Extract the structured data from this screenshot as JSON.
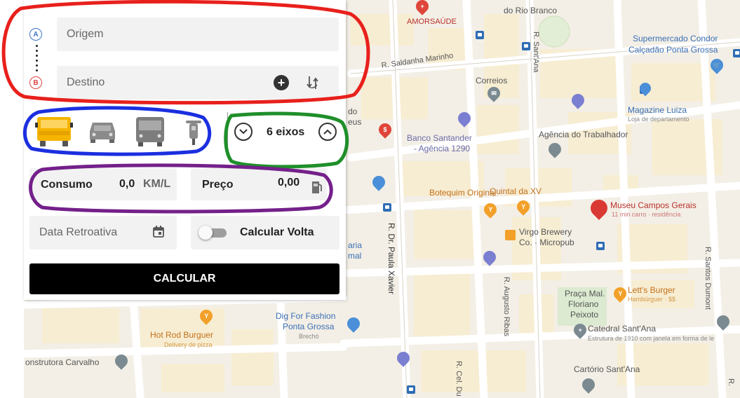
{
  "panel": {
    "origin_placeholder": "Origem",
    "destination_placeholder": "Destino",
    "origin_marker": "A",
    "destination_marker": "B",
    "vehicles": [
      {
        "name": "truck",
        "selected": true
      },
      {
        "name": "car",
        "selected": false
      },
      {
        "name": "bus",
        "selected": false
      },
      {
        "name": "motorcycle",
        "selected": false
      }
    ],
    "axles_label": "6 eixos",
    "consumption": {
      "label": "Consumo",
      "value": "0,0",
      "unit": "KM/L"
    },
    "price": {
      "label": "Preço",
      "value": "0,00"
    },
    "retro_date_placeholder": "Data Retroativa",
    "return_toggle": {
      "label": "Calcular Volta",
      "on": false
    },
    "calculate_label": "CALCULAR"
  },
  "map": {
    "labels": {
      "rio_branco": "do Rio Branco",
      "amorsaude": "AMORSAÚDE",
      "saldanha": "R. Saldanha Marinho",
      "r_santana": "R. Sant'Ana",
      "correios": "Correios",
      "supermercado1": "Supermercado Condor",
      "supermercado2": "Calçadão Ponta Grossa",
      "magazine": "Magazine Luiza",
      "magazine_sub": "Loja de departamento",
      "santander1": "Banco Santander",
      "santander2": "- Agência 1290",
      "agencia_trabalhador": "Agência do Trabalhador",
      "botequim": "Botequim Original",
      "quintal": "Quintal da XV",
      "museu": "Museu Campos Gerais",
      "museu_sub": "11 min carro · residência",
      "virgo1": "Virgo Brewery",
      "virgo2": "Co. · Micropub",
      "paula_xavier": "R. Dr. Paula Xavier",
      "augusto_ribas": "R. Augusto Ribas",
      "santos_dumont": "R. Santos Dumont",
      "praca1": "Praça Mal.",
      "praca2": "Floriano",
      "praca3": "Peixoto",
      "letts": "Lett's Burger",
      "letts_sub": "Hambúrguer · $$",
      "catedral": "Catedral Sant'Ana",
      "catedral_sub": "Estrutura de 1910 com janela em forma de le",
      "dig1": "Dig For Fashion",
      "dig2": "Ponta Grossa",
      "dig_sub": "Brechó",
      "hotrod": "Hot Rod Burguer",
      "hotrod_sub": "Delivery de pizza",
      "construtora": "onstrutora Carvalho",
      "cartorio": "Cartório Sant'Ana",
      "r_cel": "R. Cel. Du",
      "r_edge": "R.",
      "left_edge1": "do",
      "left_edge2": "eus",
      "left_edge3": "aria",
      "left_edge4": "mal"
    }
  },
  "colors": {
    "annotation_red": "#e8201c",
    "annotation_blue": "#1b2fe0",
    "annotation_green": "#1f8f2a",
    "annotation_purple": "#74208a",
    "truck_yellow": "#f5b400",
    "button_black": "#000000"
  }
}
